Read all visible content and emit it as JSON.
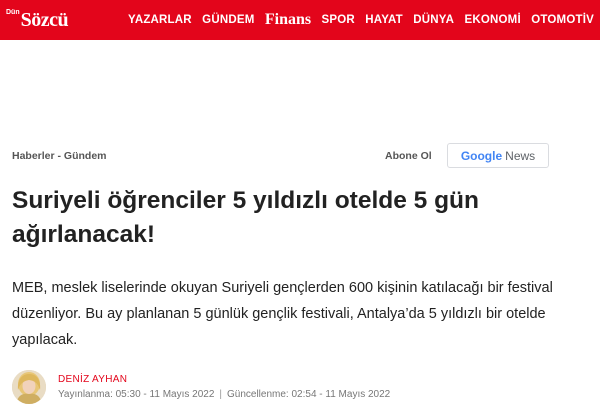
{
  "brand": {
    "logo_small": "Dün",
    "logo_text": "Sözcü",
    "color": "#e3051b"
  },
  "nav": {
    "items": [
      {
        "label": "YAZARLAR"
      },
      {
        "label": "GÜNDEM"
      },
      {
        "label": "Finans"
      },
      {
        "label": "SPOR"
      },
      {
        "label": "HAYAT"
      },
      {
        "label": "DÜNYA"
      },
      {
        "label": "EKONOMİ"
      },
      {
        "label": "OTOMOTİV"
      }
    ]
  },
  "breadcrumb": "Haberler - Gündem",
  "follow": {
    "label": "Abone Ol",
    "google": "Google",
    "news": "News"
  },
  "article": {
    "title": "Suriyeli öğrenciler 5 yıldızlı otelde 5 gün ağırlanacak!",
    "lead": "MEB, meslek liselerinde okuyan Suriyeli gençlerden 600 kişinin katılacağı bir festival düzenliyor. Bu ay planlanan 5 günlük gençlik festivali, Antalya’da 5 yıldızlı bir otelde yapılacak.",
    "author": "DENİZ AYHAN",
    "published": "Yayınlanma: 05:30 - 11 Mayıs 2022",
    "separator": "|",
    "updated": "Güncellenme: 02:54 - 11 Mayıs 2022"
  }
}
